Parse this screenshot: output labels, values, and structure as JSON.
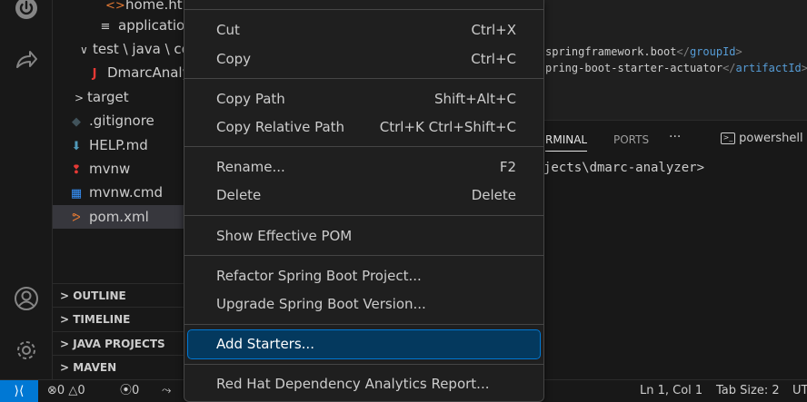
{
  "explorer": {
    "rows": [
      {
        "label": "home.html",
        "icon": "html-file-icon"
      },
      {
        "label": "application",
        "icon": "properties-file-icon"
      },
      {
        "label": "test \\ java \\ co",
        "icon": "folder-icon"
      },
      {
        "label": "DmarcAnaly",
        "icon": "java-file-icon"
      },
      {
        "label": "target",
        "icon": "folder-icon"
      },
      {
        "label": ".gitignore",
        "icon": "git-icon"
      },
      {
        "label": "HELP.md",
        "icon": "markdown-icon"
      },
      {
        "label": "mvnw",
        "icon": "maven-wrapper-icon"
      },
      {
        "label": "mvnw.cmd",
        "icon": "windows-cmd-icon"
      },
      {
        "label": "pom.xml",
        "icon": "xml-rss-icon"
      }
    ],
    "sections": [
      "OUTLINE",
      "TIMELINE",
      "JAVA PROJECTS",
      "MAVEN"
    ]
  },
  "editor": {
    "lines": [
      {
        "prefix": "springframework.boot",
        "close_tag": "groupId"
      },
      {
        "prefix": "pring-boot-starter-actuator",
        "close_tag": "artifactId"
      }
    ]
  },
  "panel": {
    "tabs": [
      "RMINAL",
      "PORTS"
    ],
    "more": "···",
    "shell": "powershell",
    "terminal_line": "jects\\dmarc-analyzer>"
  },
  "status_bar": {
    "errors": "0",
    "warnings": "0",
    "ports": "0",
    "position": "Ln 1, Col 1",
    "tab_size": "Tab Size: 2",
    "encoding": "UT"
  },
  "context_menu": {
    "groups": [
      [
        {
          "label": "Cut",
          "key": "Ctrl+X"
        },
        {
          "label": "Copy",
          "key": "Ctrl+C"
        }
      ],
      [
        {
          "label": "Copy Path",
          "key": "Shift+Alt+C"
        },
        {
          "label": "Copy Relative Path",
          "key": "Ctrl+K Ctrl+Shift+C"
        }
      ],
      [
        {
          "label": "Rename...",
          "key": "F2"
        },
        {
          "label": "Delete",
          "key": "Delete"
        }
      ],
      [
        {
          "label": "Show Effective POM",
          "key": ""
        }
      ],
      [
        {
          "label": "Refactor Spring Boot Project...",
          "key": ""
        },
        {
          "label": "Upgrade Spring Boot Version...",
          "key": ""
        }
      ],
      [
        {
          "label": "Add Starters...",
          "key": ""
        }
      ],
      [
        {
          "label": "Red Hat Dependency Analytics Report...",
          "key": ""
        }
      ]
    ],
    "highlighted": "Add Starters...",
    "accent": "#0078d4"
  }
}
